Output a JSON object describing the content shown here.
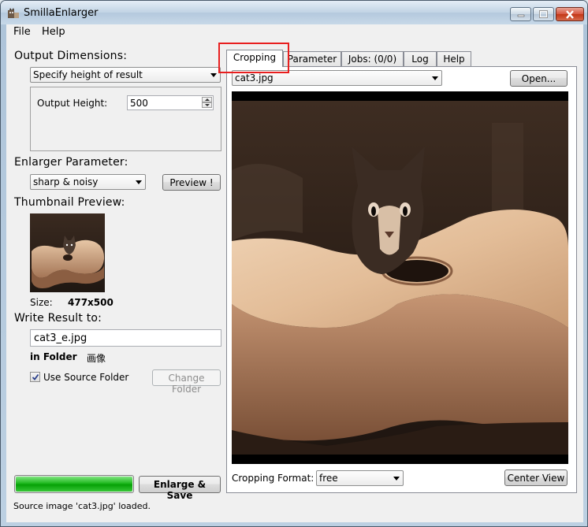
{
  "window": {
    "title": "SmillaEnlarger"
  },
  "menu": {
    "file": "File",
    "help": "Help"
  },
  "left": {
    "output_dimensions_label": "Output Dimensions:",
    "dimension_mode": "Specify height of result",
    "output_height_label": "Output Height:",
    "output_height_value": "500",
    "enlarger_parameter_label": "Enlarger Parameter:",
    "parameter_preset": "sharp & noisy",
    "preview_button": "Preview !",
    "thumbnail_label": "Thumbnail Preview:",
    "size_label": "Size:",
    "size_value": "477x500",
    "write_result_label": "Write Result to:",
    "output_filename": "cat3_e.jpg",
    "in_folder_label": "in Folder",
    "folder_value": "画像",
    "use_source_folder_label": "Use Source Folder",
    "use_source_folder_checked": true,
    "change_folder_button": "Change Folder",
    "progress_fraction": 1.0,
    "enlarge_save_button": "Enlarge & Save"
  },
  "tabs": [
    {
      "label": "Cropping",
      "active": true
    },
    {
      "label": "Parameter",
      "active": false
    },
    {
      "label": "Jobs: (0/0)",
      "active": false
    },
    {
      "label": "Log",
      "active": false
    },
    {
      "label": "Help",
      "active": false
    }
  ],
  "cropping": {
    "file_select": "cat3.jpg",
    "open_button": "Open...",
    "format_label": "Cropping Format:",
    "format_value": "free",
    "center_view_button": "Center View"
  },
  "status": {
    "message": "Source image 'cat3.jpg' loaded."
  },
  "colors": {
    "highlight": "#e81f1f",
    "progress": "#06a106"
  },
  "icons": {
    "app": "app-cat-icon",
    "minimize": "minimize-icon",
    "maximize": "maximize-icon",
    "close": "close-icon"
  }
}
